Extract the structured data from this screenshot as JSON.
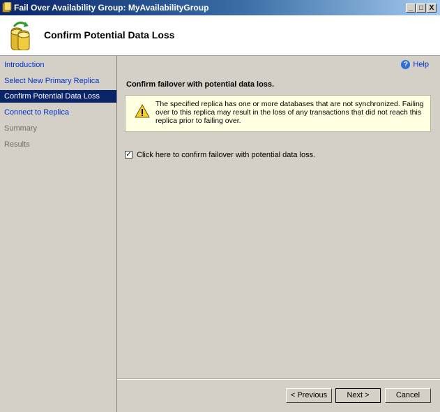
{
  "window": {
    "title": "Fail Over Availability Group: MyAvailabilityGroup",
    "controls": [
      "_",
      "□",
      "X"
    ]
  },
  "header": {
    "title": "Confirm Potential Data Loss",
    "icon": "database-icon"
  },
  "sidebar": {
    "items": [
      {
        "label": "Introduction",
        "state": "link"
      },
      {
        "label": "Select New Primary Replica",
        "state": "link"
      },
      {
        "label": "Confirm Potential Data Loss",
        "state": "active"
      },
      {
        "label": "Connect to Replica",
        "state": "link"
      },
      {
        "label": "Summary",
        "state": "disabled"
      },
      {
        "label": "Results",
        "state": "disabled"
      }
    ]
  },
  "main": {
    "help_label": "Help",
    "heading": "Confirm failover with potential data loss.",
    "warning": "The specified replica has one or more databases that are not synchronized. Failing over to this replica may result in the loss of any transactions that did not reach this replica prior to failing over.",
    "confirm_checked": true,
    "confirm_label": "Click here to confirm failover with potential data loss."
  },
  "buttons": {
    "previous": "< Previous",
    "next": "Next >",
    "cancel": "Cancel"
  },
  "colors": {
    "title_bar": "#0a246a",
    "active_nav": "#0a246a",
    "link": "#0033cc",
    "warning_bg": "#ffffe1"
  }
}
